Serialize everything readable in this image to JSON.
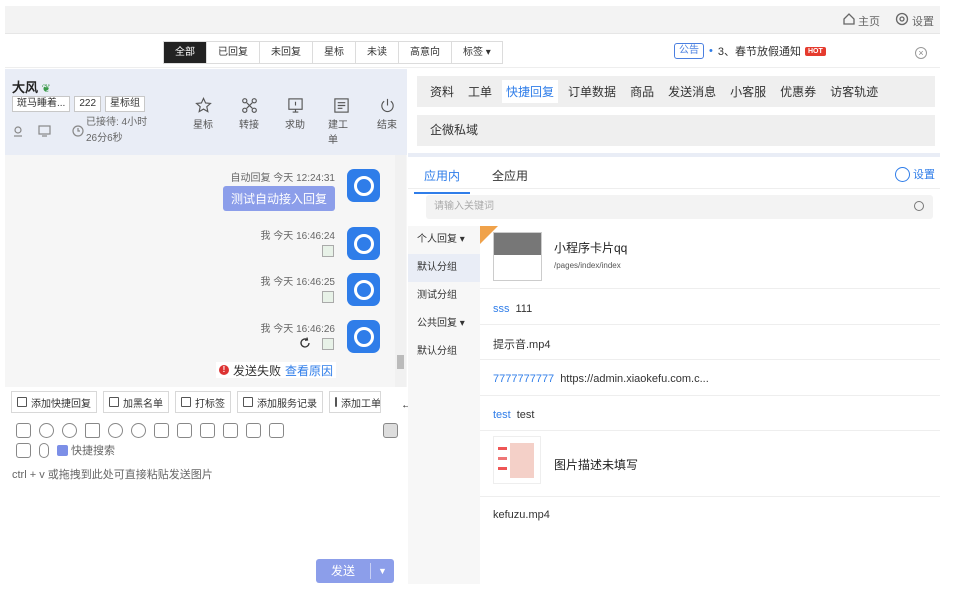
{
  "topbar": {
    "home_label": "主页",
    "settings_label": "设置"
  },
  "filters": {
    "tabs": [
      "全部",
      "已回复",
      "未回复",
      "星标",
      "未读",
      "高意向",
      "标签 ▾"
    ],
    "active": 0
  },
  "notice": {
    "tag": "公告",
    "text": "3、春节放假通知",
    "hot": "HOT"
  },
  "visitor": {
    "name": "大风",
    "tags": [
      "斑马睡着...",
      "222",
      "星标组"
    ],
    "wait_label": "已接待: 4小时26分6秒"
  },
  "actions": [
    "星标",
    "转接",
    "求助",
    "建工单",
    "结束"
  ],
  "messages": [
    {
      "meta": "自动回复  今天 12:24:31",
      "bubble": "测试自动接入回复"
    },
    {
      "meta": "我  今天 16:46:24"
    },
    {
      "meta": "我  今天 16:46:25"
    },
    {
      "meta": "我  今天 16:46:26"
    }
  ],
  "fail": {
    "text": "发送失败",
    "link": "查看原因"
  },
  "quick_buttons": [
    "添加快捷回复",
    "加黑名单",
    "打标签",
    "添加服务记录",
    "添加工单"
  ],
  "quick_search_label": "快捷搜索",
  "input_hint": "ctrl + v 或拖拽到此处可直接粘贴发送图片",
  "send_label": "发送",
  "right_tabs": [
    "资料",
    "工单",
    "快捷回复",
    "订单数据",
    "商品",
    "发送消息",
    "小客服",
    "优惠券",
    "访客轨迹"
  ],
  "right_tab_active": 2,
  "right_tabs2": [
    "企微私域"
  ],
  "panel_tabs": [
    "应用内",
    "全应用"
  ],
  "panel_setting": "设置",
  "search_placeholder": "请输入关键词",
  "side": [
    "个人回复 ▾",
    "默认分组",
    "测试分组",
    "公共回复 ▾",
    "默认分组"
  ],
  "items": [
    {
      "type": "card",
      "title": "小程序卡片qq",
      "path": "/pages/index/index"
    },
    {
      "type": "kv",
      "key": "sss",
      "value": "111"
    },
    {
      "type": "text",
      "value": "提示音.mp4"
    },
    {
      "type": "kv",
      "key": "7777777777",
      "value": "https://admin.xiaokefu.com.c..."
    },
    {
      "type": "kv",
      "key": "test",
      "value": "test"
    },
    {
      "type": "image",
      "value": "图片描述未填写"
    },
    {
      "type": "text",
      "value": "kefuzu.mp4"
    }
  ]
}
